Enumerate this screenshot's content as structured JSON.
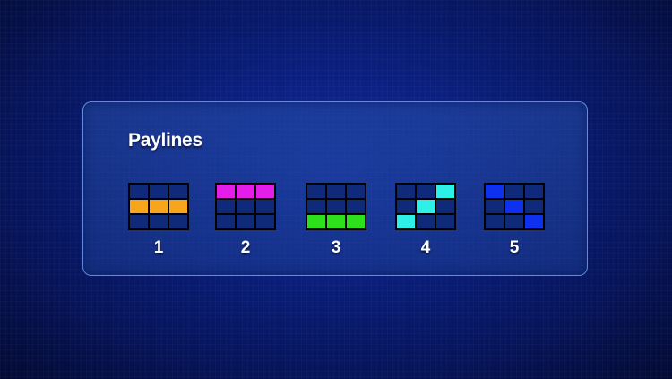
{
  "title": "Paylines",
  "colors": {
    "empty_cell": "#0f2a78",
    "grid_border": "#000000"
  },
  "paylines": [
    {
      "number": "1",
      "color": "#f7a51c",
      "cells": [
        [
          0,
          0,
          0
        ],
        [
          1,
          1,
          1
        ],
        [
          0,
          0,
          0
        ]
      ]
    },
    {
      "number": "2",
      "color": "#e21ee8",
      "cells": [
        [
          1,
          1,
          1
        ],
        [
          0,
          0,
          0
        ],
        [
          0,
          0,
          0
        ]
      ]
    },
    {
      "number": "3",
      "color": "#2ee01c",
      "cells": [
        [
          0,
          0,
          0
        ],
        [
          0,
          0,
          0
        ],
        [
          1,
          1,
          1
        ]
      ]
    },
    {
      "number": "4",
      "color": "#2ff0e6",
      "cells": [
        [
          0,
          0,
          1
        ],
        [
          0,
          1,
          0
        ],
        [
          1,
          0,
          0
        ]
      ]
    },
    {
      "number": "5",
      "color": "#1030f0",
      "cells": [
        [
          1,
          0,
          0
        ],
        [
          0,
          1,
          0
        ],
        [
          0,
          0,
          1
        ]
      ]
    }
  ]
}
